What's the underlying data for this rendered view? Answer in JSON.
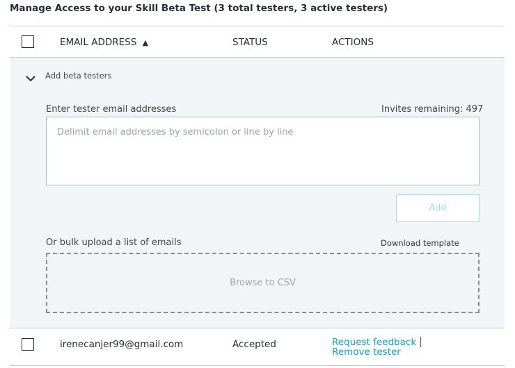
{
  "header": {
    "title": "Manage Access to your Skill Beta Test (3 total testers, 3 active testers)"
  },
  "table": {
    "columns": {
      "email": "EMAIL ADDRESS",
      "sort_indicator": "▲",
      "status": "STATUS",
      "actions": "ACTIONS"
    },
    "rows": [
      {
        "email": "irenecanjer99@gmail.com",
        "status": "Accepted",
        "actions": [
          "Request feedback",
          "Remove tester"
        ]
      }
    ]
  },
  "add_panel": {
    "toggle_label": "Add beta testers",
    "emails_label": "Enter tester email addresses",
    "invites_remaining": "Invites remaining: 497",
    "emails_placeholder": "Delimit email addresses by semicolon or line by line",
    "add_button": "Add",
    "bulk_label": "Or bulk upload a list of emails",
    "download_template": "Download template",
    "browse_csv": "Browse to CSV"
  },
  "colors": {
    "link": "#1a9bc7",
    "panel_bg": "#f2f5f7",
    "disabled_button": "#a7d7e6",
    "text": "#232f3e"
  },
  "icons": {
    "toggle": "chevron-down-icon",
    "sort": "sort-ascending-icon"
  }
}
